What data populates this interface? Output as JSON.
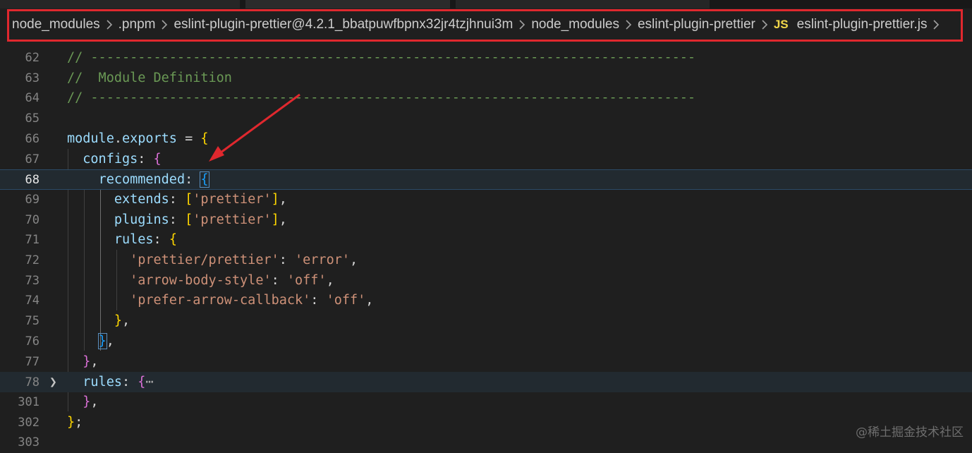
{
  "breadcrumb": {
    "items": [
      "node_modules",
      ".pnpm",
      "eslint-plugin-prettier@4.2.1_bbatpuwfbpnx32jr4tzjhnui3m",
      "node_modules",
      "eslint-plugin-prettier"
    ],
    "file_badge": "JS",
    "file_name": "eslint-plugin-prettier.js"
  },
  "editor": {
    "lines": [
      {
        "num": "62",
        "code": "// -----------------------------------------------------------------------------"
      },
      {
        "num": "63",
        "code": "//  Module Definition"
      },
      {
        "num": "64",
        "code": "// -----------------------------------------------------------------------------"
      },
      {
        "num": "65",
        "code": ""
      },
      {
        "num": "66",
        "code": "module.exports = {"
      },
      {
        "num": "67",
        "code": "  configs: {"
      },
      {
        "num": "68",
        "code": "    recommended: {"
      },
      {
        "num": "69",
        "code": "      extends: ['prettier'],"
      },
      {
        "num": "70",
        "code": "      plugins: ['prettier'],"
      },
      {
        "num": "71",
        "code": "      rules: {"
      },
      {
        "num": "72",
        "code": "        'prettier/prettier': 'error',"
      },
      {
        "num": "73",
        "code": "        'arrow-body-style': 'off',"
      },
      {
        "num": "74",
        "code": "        'prefer-arrow-callback': 'off',"
      },
      {
        "num": "75",
        "code": "      },"
      },
      {
        "num": "76",
        "code": "    },"
      },
      {
        "num": "77",
        "code": "  },"
      },
      {
        "num": "78",
        "code": "  rules: {⋯"
      },
      {
        "num": "301",
        "code": "  },"
      },
      {
        "num": "302",
        "code": "};"
      },
      {
        "num": "303",
        "code": ""
      }
    ],
    "current_line": "68",
    "folded_line": "78"
  },
  "watermark": "@稀土掘金技术社区",
  "colors": {
    "annotation": "#e0282e",
    "comment": "#6a9955",
    "property": "#9cdcfe",
    "string": "#ce9178",
    "js_badge": "#f1d74a"
  }
}
